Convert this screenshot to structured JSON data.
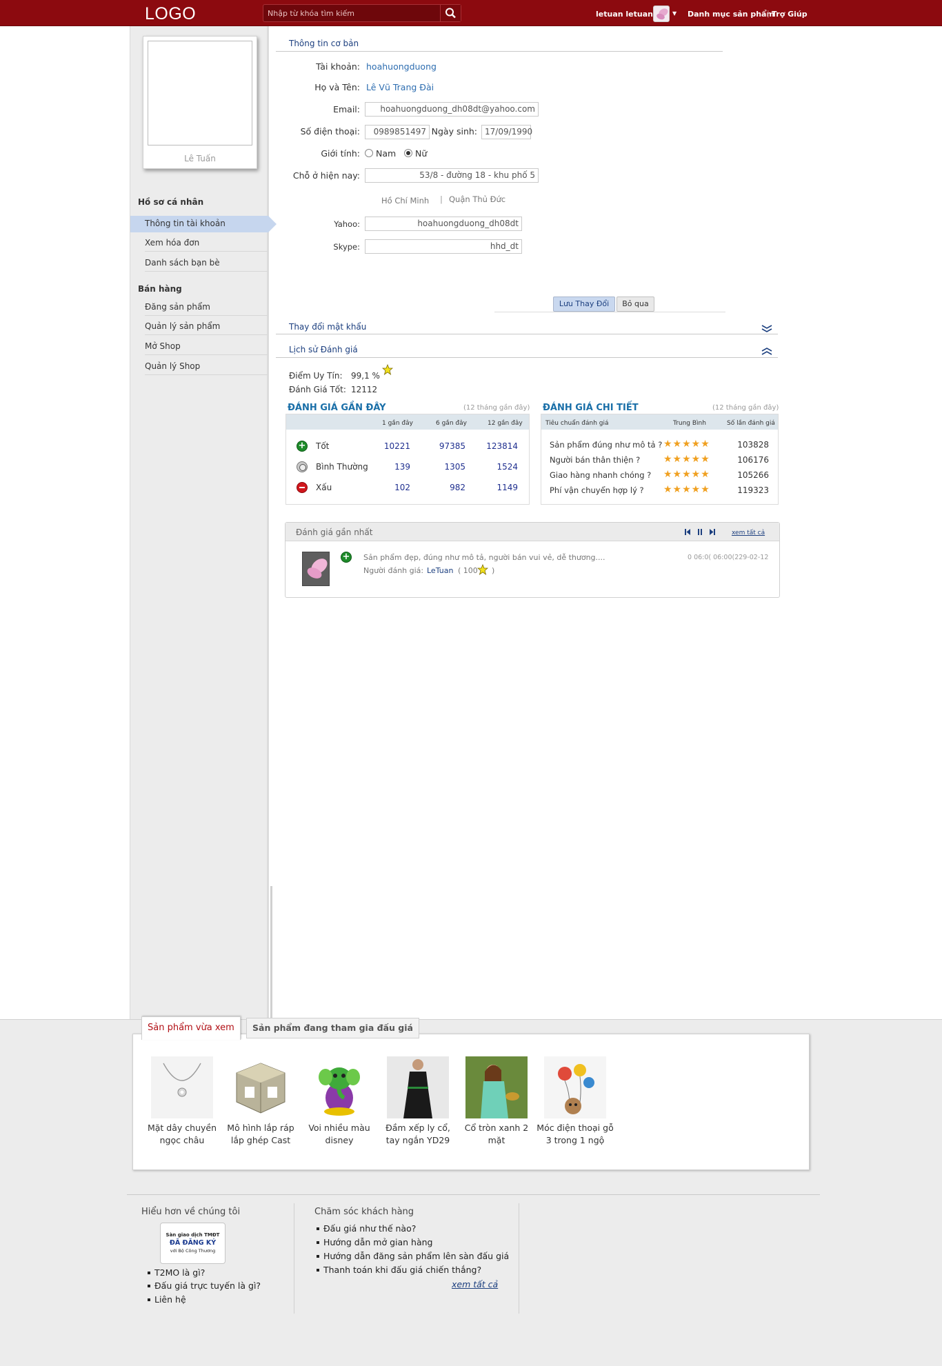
{
  "header": {
    "logo": "LOGO",
    "search_placeholder": "Nhập từ khóa tìm kiếm",
    "user_name": "letuan letuan...",
    "nav_category": "Danh mục sản phẩm",
    "nav_separator": "|",
    "nav_help": "Trợ Giúp"
  },
  "sidebar": {
    "avatar_name": "Lê Tuấn",
    "section_profile": "Hồ sơ cá nhân",
    "profile_items": [
      "Thông tin tài khoản",
      "Xem hóa đơn",
      "Danh sách bạn bè"
    ],
    "section_sales": "Bán hàng",
    "sales_items": [
      "Đăng sản phẩm",
      "Quản lý sản phẩm",
      "Mở Shop",
      "Quản lý Shop"
    ]
  },
  "basic_info": {
    "title": "Thông tin cơ bản",
    "account_label": "Tài khoản:",
    "account_value": "hoahuongduong",
    "fullname_label": "Họ và Tên:",
    "fullname_value": "Lê Vũ Trang Đài",
    "email_label": "Email:",
    "email_value": "hoahuongduong_dh08dt@yahoo.com",
    "phone_label": "Số điện thoại:",
    "phone_value": "0989851497",
    "birth_label": "Ngày sinh:",
    "birth_value": "17/09/1990",
    "gender_label": "Giới tính:",
    "gender_male": "Nam",
    "gender_female": "Nữ",
    "gender_selected": "Nữ",
    "address_label": "Chỗ ở hiện nay:",
    "address_value": "53/8 - đường 18 - khu phố 5",
    "city": "Hồ Chí Minh",
    "city_separator": "|",
    "district": "Quận Thủ Đức",
    "yahoo_label": "Yahoo:",
    "yahoo_value": "hoahuongduong_dh08dt",
    "skype_label": "Skype:",
    "skype_value": "hhd_dt",
    "save_button": "Lưu Thay Đổi",
    "cancel_button": "Bỏ qua"
  },
  "change_password": {
    "title": "Thay đổi mật khẩu"
  },
  "rating_history": {
    "title": "Lịch sử Đánh giá",
    "reputation_label": "Điểm Uy Tín:",
    "reputation_value": "99,1 %",
    "good_label": "Đánh Giá Tốt:",
    "good_value": "12112"
  },
  "recent_ratings": {
    "title": "ĐÁNH GIÁ GẦN ĐÂY",
    "note": "(12 tháng gần đây)",
    "columns": [
      "1 gần đây",
      "6 gần đây",
      "12 gần đây"
    ],
    "rows": [
      {
        "label": "Tốt",
        "values": [
          "10221",
          "97385",
          "123814"
        ]
      },
      {
        "label": "Bình Thường",
        "values": [
          "139",
          "1305",
          "1524"
        ]
      },
      {
        "label": "Xấu",
        "values": [
          "102",
          "982",
          "1149"
        ]
      }
    ]
  },
  "detail_ratings": {
    "title": "ĐÁNH GIÁ CHI TIẾT",
    "note": "(12 tháng gần đây)",
    "columns": [
      "Tiêu chuẩn đánh giá",
      "Trung Bình",
      "Số lần đánh giá"
    ],
    "rows": [
      {
        "criterion": "Sản phẩm đúng như mô tả ?",
        "stars": 5,
        "count": "103828"
      },
      {
        "criterion": "Người bán thân thiện ?",
        "stars": 5,
        "count": "106176"
      },
      {
        "criterion": "Giao hàng nhanh chóng ?",
        "stars": 5,
        "count": "105266"
      },
      {
        "criterion": "Phí vận chuyển hợp lý ?",
        "stars": 5,
        "count": "119323"
      }
    ]
  },
  "latest_rating": {
    "title": "Đánh giá gần nhất",
    "view_all": "xem tất cả",
    "comment": "Sản phẩm đẹp, đúng như mô tả, người bán vui vẻ, dễ thương....",
    "reviewer_label": "Người đánh giá:",
    "reviewer_name": "LeTuan",
    "reviewer_score_open": "( 100",
    "reviewer_score_close": ")",
    "timestamp": "0 06:0( 06:00(229-02-12"
  },
  "viewed_products": {
    "tab_viewed": "Sản phẩm vừa xem",
    "tab_auction": "Sản phẩm đang tham gia đấu giá",
    "items": [
      {
        "name": "Mặt dây chuyền ngọc châu"
      },
      {
        "name": "Mô hình lắp ráp lắp ghép Cast"
      },
      {
        "name": "Voi nhiều màu disney"
      },
      {
        "name": "Đầm xếp ly cổ, tay ngắn YD29"
      },
      {
        "name": "Cổ tròn xanh 2 mặt"
      },
      {
        "name": "Móc điện thoại gỗ 3 trong 1 ngộ"
      }
    ]
  },
  "footer": {
    "about_title": "Hiểu hơn về chúng tôi",
    "badge_line1": "Sàn giao dịch TMĐT",
    "badge_line2": "ĐÃ ĐĂNG KÝ",
    "badge_line3": "với Bộ Công Thương",
    "about_links": [
      "T2MO là gì?",
      "Đấu giá trực tuyến là gì?",
      "Liên hệ"
    ],
    "care_title": "Chăm sóc khách hàng",
    "care_links": [
      "Đấu giá như thế nào?",
      "Hướng dẫn mở gian hàng",
      "Hướng dẫn đăng sản phẩm lên sàn đấu giá",
      "Thanh toán khi đấu giá chiến thắng?"
    ],
    "care_view_all": "xem tất cả"
  },
  "colors": {
    "brand_red": "#8c0a0f",
    "link_blue": "#2d6db0",
    "heading_blue": "#1a6fa8",
    "star_orange": "#f0a020"
  }
}
